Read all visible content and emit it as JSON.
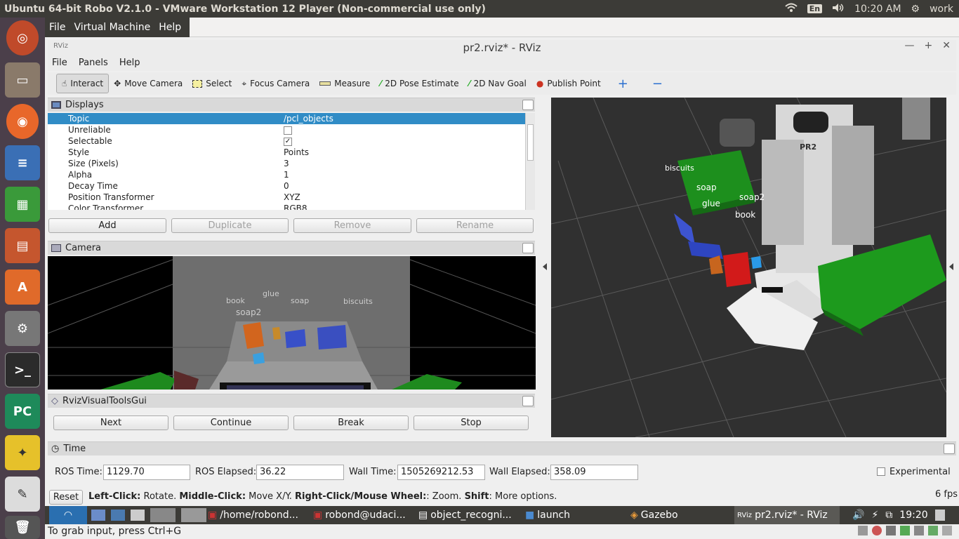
{
  "host": {
    "title": "Ubuntu 64-bit Robo V2.1.0 - VMware Workstation 12 Player (Non-commercial use only)",
    "lang": "En",
    "clock": "10:20 AM",
    "user": "work"
  },
  "vm_menu": {
    "items": [
      "File",
      "Virtual Machine",
      "Help"
    ]
  },
  "rviz": {
    "title": "pr2.rviz* - RViz",
    "menu": [
      "File",
      "Panels",
      "Help"
    ]
  },
  "toolbar": {
    "tools": [
      {
        "label": "Interact",
        "icon": "hand-icon",
        "active": true
      },
      {
        "label": "Move Camera",
        "icon": "move-camera-icon"
      },
      {
        "label": "Select",
        "icon": "select-icon"
      },
      {
        "label": "Focus Camera",
        "icon": "focus-camera-icon"
      },
      {
        "label": "Measure",
        "icon": "ruler-icon"
      },
      {
        "label": "2D Pose Estimate",
        "icon": "pose-arrow-icon",
        "color": "#22aa22"
      },
      {
        "label": "2D Nav Goal",
        "icon": "nav-arrow-icon",
        "color": "#22aa22"
      },
      {
        "label": "Publish Point",
        "icon": "map-pin-icon",
        "color": "#cc3322"
      }
    ]
  },
  "displays": {
    "title": "Displays",
    "rows": [
      {
        "k": "Topic",
        "v": "/pcl_objects"
      },
      {
        "k": "Unreliable",
        "v": ""
      },
      {
        "k": "Selectable",
        "v": "✓"
      },
      {
        "k": "Style",
        "v": "Points"
      },
      {
        "k": "Size (Pixels)",
        "v": "3"
      },
      {
        "k": "Alpha",
        "v": "1"
      },
      {
        "k": "Decay Time",
        "v": "0"
      },
      {
        "k": "Position Transformer",
        "v": "XYZ"
      },
      {
        "k": "Color Transformer",
        "v": "RGB8"
      }
    ],
    "buttons": [
      "Add",
      "Duplicate",
      "Remove",
      "Rename"
    ]
  },
  "camera": {
    "title": "Camera",
    "labels": [
      "book",
      "glue",
      "soap",
      "biscuits",
      "soap2"
    ]
  },
  "visual_tools": {
    "title": "RvizVisualToolsGui",
    "buttons": [
      "Next",
      "Continue",
      "Break",
      "Stop"
    ]
  },
  "view3d": {
    "labels": [
      "biscuits",
      "soap",
      "soap2",
      "glue",
      "book"
    ],
    "robot_label": "PR2"
  },
  "time": {
    "title": "Time",
    "ros_time_label": "ROS Time:",
    "ros_time": "1129.70",
    "ros_elapsed_label": "ROS Elapsed:",
    "ros_elapsed": "36.22",
    "wall_time_label": "Wall Time:",
    "wall_time": "1505269212.53",
    "wall_elapsed_label": "Wall Elapsed:",
    "wall_elapsed": "358.09",
    "experimental": "Experimental"
  },
  "hint": {
    "reset": "Reset",
    "b1": "Left-Click:",
    "t1": " Rotate. ",
    "b2": "Middle-Click:",
    "t2": " Move X/Y. ",
    "b3": "Right-Click/Mouse Wheel:",
    "t3": ": Zoom. ",
    "b4": "Shift",
    "t4": ": More options.",
    "fps": "6 fps"
  },
  "taskbar": {
    "items": [
      "/home/robond...",
      "robond@udaci...",
      "object_recogni...",
      "launch",
      "Gazebo",
      "pr2.rviz* - RViz"
    ],
    "clock": "19:20"
  },
  "status": "To grab input, press Ctrl+G"
}
